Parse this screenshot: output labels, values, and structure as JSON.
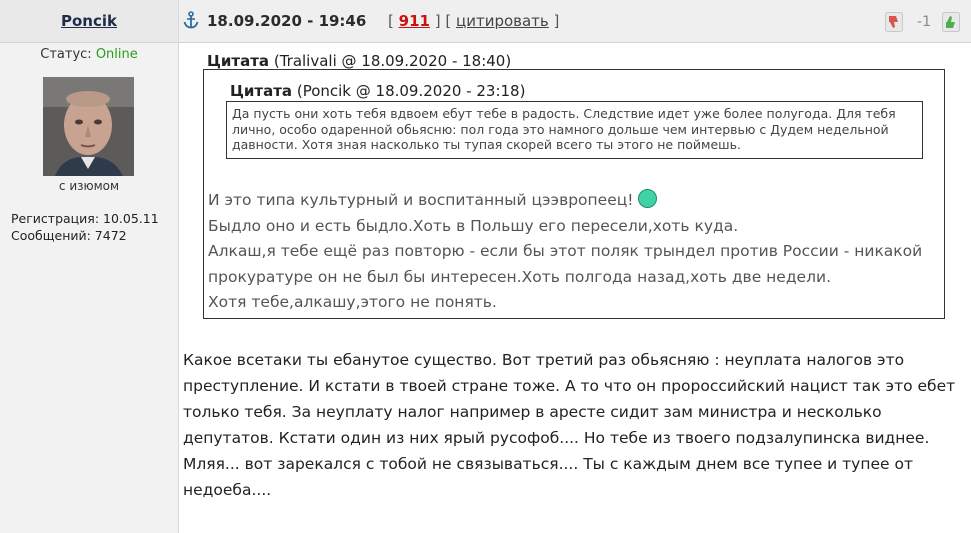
{
  "author": {
    "name": "Poncik",
    "status_label": "Статус:",
    "status_value": "Online",
    "avatar_caption": "с изюмом",
    "registration": "Регистрация: 10.05.11",
    "messages": "Сообщений: 7472"
  },
  "post": {
    "datetime": "18.09.2020 - 19:46",
    "bracket_open": "[",
    "number": "911",
    "bracket_mid": "] [",
    "quote_action": "цитировать",
    "bracket_close": "]",
    "rating": "-1",
    "body": "Какое всетаки ты ебанутое существо. Вот третий раз обьясняю : неуплата налогов это преступление. И кстати в твоей стране тоже. А то что он пророссийский нацист так это ебет только тебя. За неуплату налог например в аресте сидит зам министра и несколько депутатов. Кстати один из них ярый русофоб.... Но тебе из твоего подзалупинска виднее. Мляя... вот зарекался с тобой не связываться.... Ты с каждым днем все тупее и тупее от недоеба...."
  },
  "quote_outer": {
    "label": "Цитата",
    "source": "(Tralivali @ 18.09.2020 - 18:40)",
    "lines": [
      "И это типа культурный и воспитанный цээвропеец!",
      "Быдло оно и есть быдло.Хоть в Польшу его пересели,хоть куда.",
      "Алкаш,я тебе ещё раз повторю - если бы этот поляк трындел против России - никакой прокуратуре он не был бы интересен.Хоть полгода назад,хоть две недели.",
      "Хотя тебе,алкашу,этого не понять."
    ]
  },
  "quote_inner": {
    "label": "Цитата",
    "source": "(Poncik @ 18.09.2020 - 23:18)",
    "text": "Да пусть они хоть тебя вдвоем ебут тебе в радость. Следствие идет уже более полугода. Для тебя лично, особо одаренной обьясню: пол года это намного дольше чем интервью с Дудем недельной давности.  Хотя зная насколько ты тупая скорей всего ты этого не поймешь."
  },
  "icons": {
    "anchor": "anchor-icon",
    "vote_down": "thumbs-down-icon",
    "vote_up": "thumbs-up-icon",
    "emoji": "green-smiley-icon"
  },
  "colors": {
    "online": "#2a9d1b",
    "post_number": "#cc1111",
    "vote_down": "#d9534f",
    "vote_up": "#4cae4c"
  }
}
